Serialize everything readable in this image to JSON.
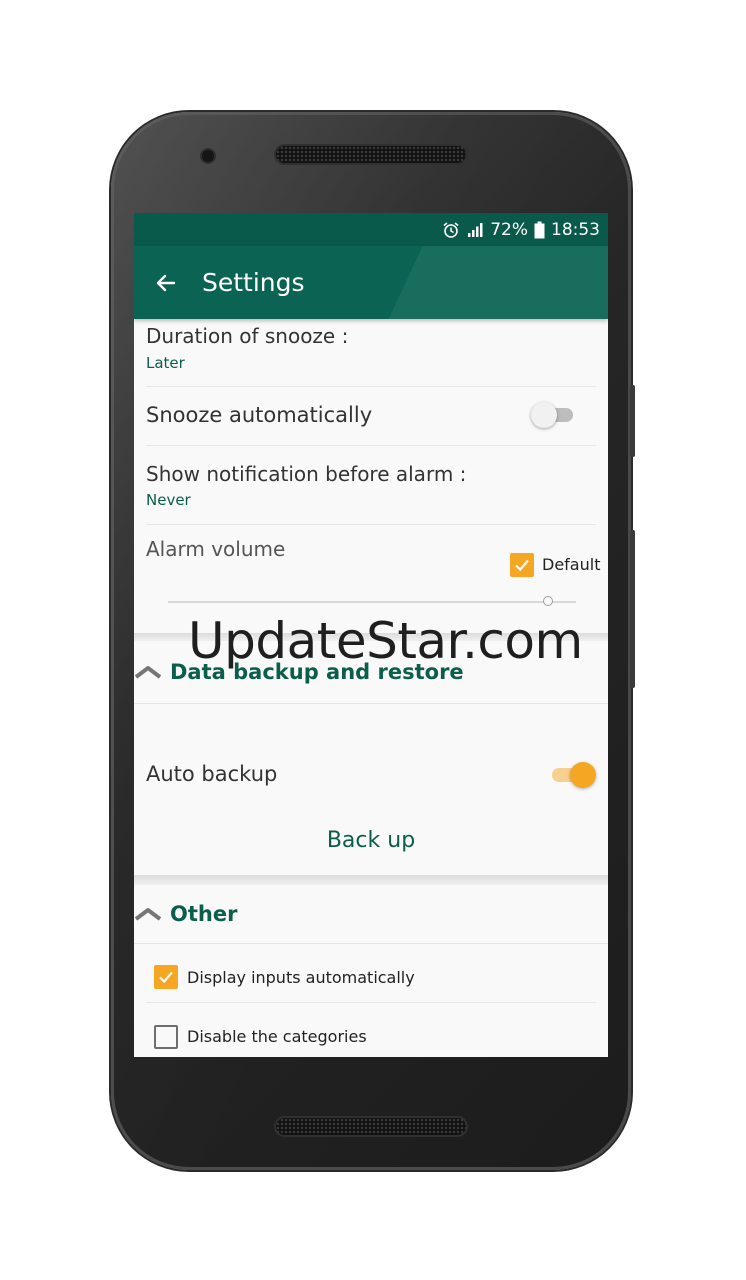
{
  "status_bar": {
    "battery": "72%",
    "time": "18:53"
  },
  "app_bar": {
    "title": "Settings"
  },
  "settings": {
    "snooze_duration": {
      "title": "Duration of snooze :",
      "value": "Later"
    },
    "snooze_auto": {
      "title": "Snooze automatically",
      "enabled": false
    },
    "notify_before": {
      "title": "Show notification before alarm :",
      "value": "Never"
    },
    "alarm_volume": {
      "title": "Alarm volume",
      "default_label": "Default",
      "default_checked": true
    }
  },
  "backup_section": {
    "header": "Data backup and restore",
    "auto_backup": {
      "title": "Auto backup",
      "enabled": true
    },
    "back_up_button": "Back up"
  },
  "other_section": {
    "header": "Other",
    "display_inputs": {
      "label": "Display inputs automatically",
      "checked": true
    },
    "disable_categories": {
      "label": "Disable the categories",
      "checked": false
    }
  },
  "watermark": "UpdateStar.com",
  "colors": {
    "primary": "#0b6453",
    "primary_dark": "#0a5a4c",
    "accent": "#f5a623",
    "summary_text": "#0b5e4c"
  },
  "icons": [
    "alarm-icon",
    "signal-icon",
    "battery-icon",
    "back-arrow-icon",
    "collapse-chevron-icon",
    "check-icon"
  ]
}
